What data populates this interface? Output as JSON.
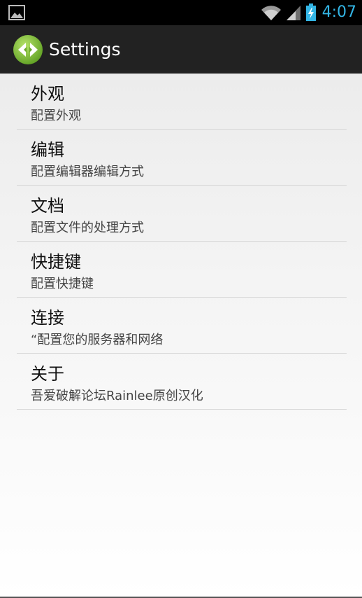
{
  "status_bar": {
    "time": "4:07",
    "icons": [
      "image-icon",
      "wifi-icon",
      "signal-icon",
      "battery-charging-icon"
    ]
  },
  "action_bar": {
    "title": "Settings",
    "icon": "app-logo-icon",
    "icon_color": "#7cc242"
  },
  "settings": {
    "items": [
      {
        "title": "外观",
        "summary": "配置外观"
      },
      {
        "title": "编辑",
        "summary": "配置编辑器编辑方式"
      },
      {
        "title": "文档",
        "summary": "配置文件的处理方式"
      },
      {
        "title": "快捷键",
        "summary": "配置快捷键"
      },
      {
        "title": "连接",
        "summary": "“配置您的服务器和网络"
      },
      {
        "title": "关于",
        "summary": "吾爱破解论坛Rainlee原创汉化"
      }
    ]
  },
  "colors": {
    "status_time": "#33b5e5",
    "action_bar_bg": "#222222",
    "status_bar_bg": "#000000"
  }
}
